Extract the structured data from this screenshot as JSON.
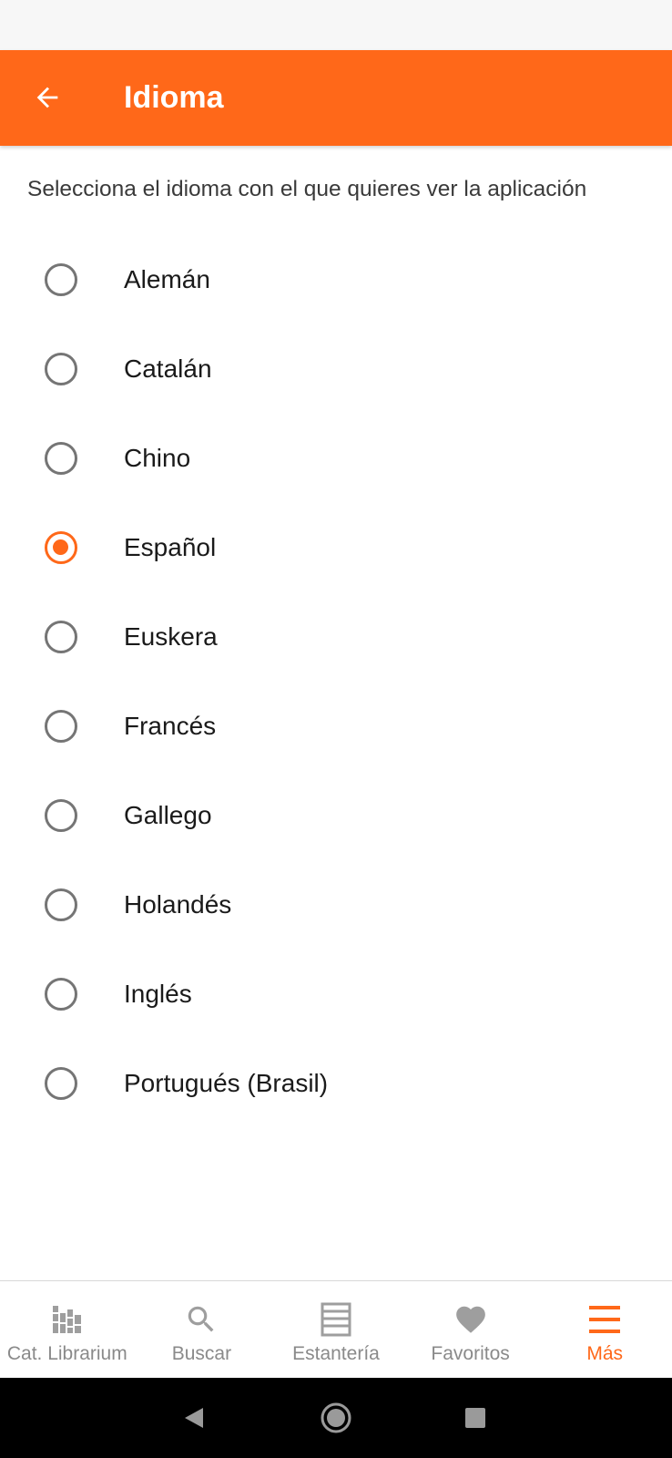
{
  "app_bar": {
    "title": "Idioma",
    "background": "#ff6819",
    "back_icon": "arrow-left-icon"
  },
  "description": "Selecciona el idioma con el que quieres ver la aplicación",
  "languages": [
    {
      "label": "Alemán",
      "selected": false
    },
    {
      "label": "Catalán",
      "selected": false
    },
    {
      "label": "Chino",
      "selected": false
    },
    {
      "label": "Español",
      "selected": true
    },
    {
      "label": "Euskera",
      "selected": false
    },
    {
      "label": "Francés",
      "selected": false
    },
    {
      "label": "Gallego",
      "selected": false
    },
    {
      "label": "Holandés",
      "selected": false
    },
    {
      "label": "Inglés",
      "selected": false
    },
    {
      "label": "Portugués (Brasil)",
      "selected": false
    }
  ],
  "bottom_nav": {
    "items": [
      {
        "label": "Cat. Librarium",
        "icon": "library-icon",
        "active": false
      },
      {
        "label": "Buscar",
        "icon": "search-icon",
        "active": false
      },
      {
        "label": "Estantería",
        "icon": "shelf-icon",
        "active": false
      },
      {
        "label": "Favoritos",
        "icon": "heart-icon",
        "active": false
      },
      {
        "label": "Más",
        "icon": "menu-icon",
        "active": true
      }
    ]
  },
  "colors": {
    "accent": "#ff6819",
    "inactive": "#8a8a8a",
    "radio_unchecked": "#757575"
  }
}
